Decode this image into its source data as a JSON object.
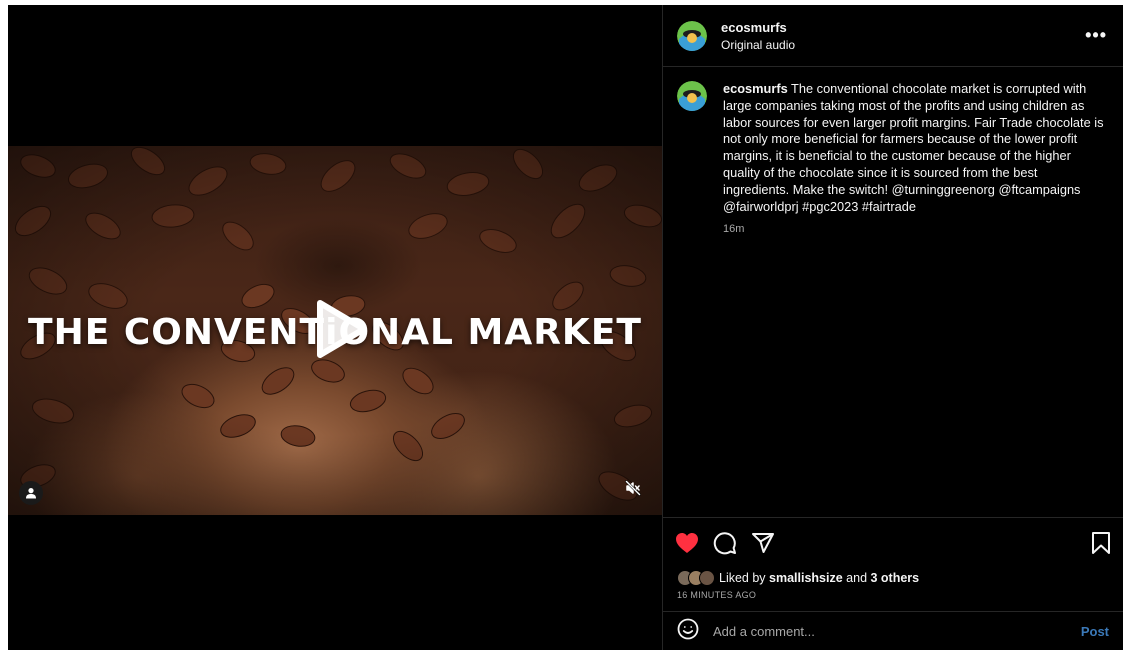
{
  "post": {
    "username": "ecosmurfs",
    "audio": "Original audio",
    "more_label": "•••"
  },
  "video": {
    "overlay_title": "THE CONVENTiONAL MARKET"
  },
  "caption": {
    "username": "ecosmurfs",
    "text": " The conventional chocolate market is corrupted with large companies taking most of the profits and using children as labor sources for even larger profit margins. Fair Trade chocolate is not only more beneficial for farmers because of the lower profit margins, it is beneficial to the customer because of the higher quality of the chocolate since it is sourced from the best ingredients. Make the switch! @turninggreenorg @ftcampaigns @fairworldprj #pgc2023 #fairtrade",
    "time": "16m"
  },
  "likes": {
    "prefix": "Liked by ",
    "first_user": "smallishsize",
    "middle": " and ",
    "others": "3 others",
    "ago": "16 MINUTES AGO"
  },
  "comment": {
    "placeholder": "Add a comment...",
    "post_label": "Post"
  },
  "colors": {
    "like_red": "#ff3040",
    "post_blue": "#3b79b8"
  },
  "icons": [
    "heart-icon",
    "comment-icon",
    "share-icon",
    "bookmark-icon",
    "smiley-icon",
    "play-icon",
    "mute-icon",
    "user-tag-icon"
  ]
}
